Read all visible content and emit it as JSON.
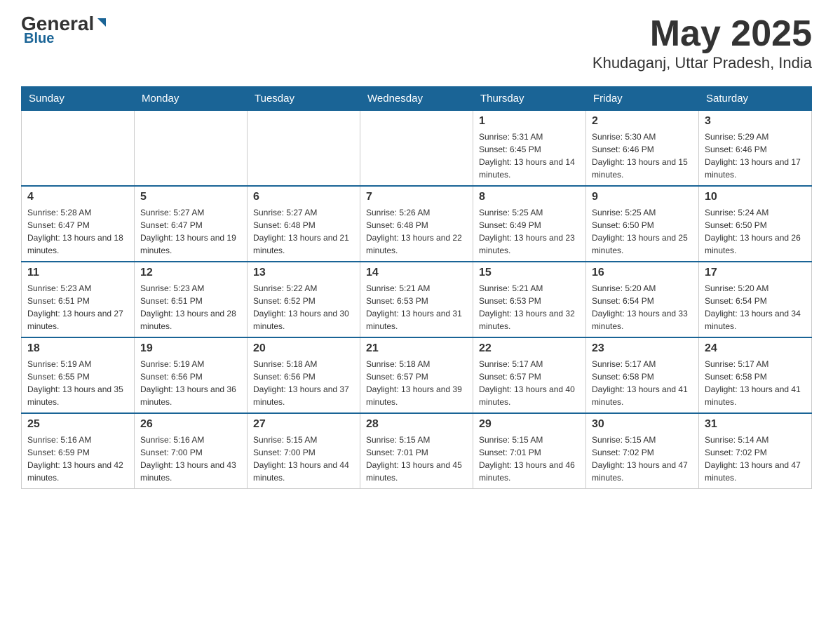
{
  "logo": {
    "general": "General",
    "triangle": "▶",
    "blue": "Blue"
  },
  "title": "May 2025",
  "subtitle": "Khudaganj, Uttar Pradesh, India",
  "weekdays": [
    "Sunday",
    "Monday",
    "Tuesday",
    "Wednesday",
    "Thursday",
    "Friday",
    "Saturday"
  ],
  "weeks": [
    [
      {
        "day": "",
        "info": ""
      },
      {
        "day": "",
        "info": ""
      },
      {
        "day": "",
        "info": ""
      },
      {
        "day": "",
        "info": ""
      },
      {
        "day": "1",
        "info": "Sunrise: 5:31 AM\nSunset: 6:45 PM\nDaylight: 13 hours and 14 minutes."
      },
      {
        "day": "2",
        "info": "Sunrise: 5:30 AM\nSunset: 6:46 PM\nDaylight: 13 hours and 15 minutes."
      },
      {
        "day": "3",
        "info": "Sunrise: 5:29 AM\nSunset: 6:46 PM\nDaylight: 13 hours and 17 minutes."
      }
    ],
    [
      {
        "day": "4",
        "info": "Sunrise: 5:28 AM\nSunset: 6:47 PM\nDaylight: 13 hours and 18 minutes."
      },
      {
        "day": "5",
        "info": "Sunrise: 5:27 AM\nSunset: 6:47 PM\nDaylight: 13 hours and 19 minutes."
      },
      {
        "day": "6",
        "info": "Sunrise: 5:27 AM\nSunset: 6:48 PM\nDaylight: 13 hours and 21 minutes."
      },
      {
        "day": "7",
        "info": "Sunrise: 5:26 AM\nSunset: 6:48 PM\nDaylight: 13 hours and 22 minutes."
      },
      {
        "day": "8",
        "info": "Sunrise: 5:25 AM\nSunset: 6:49 PM\nDaylight: 13 hours and 23 minutes."
      },
      {
        "day": "9",
        "info": "Sunrise: 5:25 AM\nSunset: 6:50 PM\nDaylight: 13 hours and 25 minutes."
      },
      {
        "day": "10",
        "info": "Sunrise: 5:24 AM\nSunset: 6:50 PM\nDaylight: 13 hours and 26 minutes."
      }
    ],
    [
      {
        "day": "11",
        "info": "Sunrise: 5:23 AM\nSunset: 6:51 PM\nDaylight: 13 hours and 27 minutes."
      },
      {
        "day": "12",
        "info": "Sunrise: 5:23 AM\nSunset: 6:51 PM\nDaylight: 13 hours and 28 minutes."
      },
      {
        "day": "13",
        "info": "Sunrise: 5:22 AM\nSunset: 6:52 PM\nDaylight: 13 hours and 30 minutes."
      },
      {
        "day": "14",
        "info": "Sunrise: 5:21 AM\nSunset: 6:53 PM\nDaylight: 13 hours and 31 minutes."
      },
      {
        "day": "15",
        "info": "Sunrise: 5:21 AM\nSunset: 6:53 PM\nDaylight: 13 hours and 32 minutes."
      },
      {
        "day": "16",
        "info": "Sunrise: 5:20 AM\nSunset: 6:54 PM\nDaylight: 13 hours and 33 minutes."
      },
      {
        "day": "17",
        "info": "Sunrise: 5:20 AM\nSunset: 6:54 PM\nDaylight: 13 hours and 34 minutes."
      }
    ],
    [
      {
        "day": "18",
        "info": "Sunrise: 5:19 AM\nSunset: 6:55 PM\nDaylight: 13 hours and 35 minutes."
      },
      {
        "day": "19",
        "info": "Sunrise: 5:19 AM\nSunset: 6:56 PM\nDaylight: 13 hours and 36 minutes."
      },
      {
        "day": "20",
        "info": "Sunrise: 5:18 AM\nSunset: 6:56 PM\nDaylight: 13 hours and 37 minutes."
      },
      {
        "day": "21",
        "info": "Sunrise: 5:18 AM\nSunset: 6:57 PM\nDaylight: 13 hours and 39 minutes."
      },
      {
        "day": "22",
        "info": "Sunrise: 5:17 AM\nSunset: 6:57 PM\nDaylight: 13 hours and 40 minutes."
      },
      {
        "day": "23",
        "info": "Sunrise: 5:17 AM\nSunset: 6:58 PM\nDaylight: 13 hours and 41 minutes."
      },
      {
        "day": "24",
        "info": "Sunrise: 5:17 AM\nSunset: 6:58 PM\nDaylight: 13 hours and 41 minutes."
      }
    ],
    [
      {
        "day": "25",
        "info": "Sunrise: 5:16 AM\nSunset: 6:59 PM\nDaylight: 13 hours and 42 minutes."
      },
      {
        "day": "26",
        "info": "Sunrise: 5:16 AM\nSunset: 7:00 PM\nDaylight: 13 hours and 43 minutes."
      },
      {
        "day": "27",
        "info": "Sunrise: 5:15 AM\nSunset: 7:00 PM\nDaylight: 13 hours and 44 minutes."
      },
      {
        "day": "28",
        "info": "Sunrise: 5:15 AM\nSunset: 7:01 PM\nDaylight: 13 hours and 45 minutes."
      },
      {
        "day": "29",
        "info": "Sunrise: 5:15 AM\nSunset: 7:01 PM\nDaylight: 13 hours and 46 minutes."
      },
      {
        "day": "30",
        "info": "Sunrise: 5:15 AM\nSunset: 7:02 PM\nDaylight: 13 hours and 47 minutes."
      },
      {
        "day": "31",
        "info": "Sunrise: 5:14 AM\nSunset: 7:02 PM\nDaylight: 13 hours and 47 minutes."
      }
    ]
  ]
}
